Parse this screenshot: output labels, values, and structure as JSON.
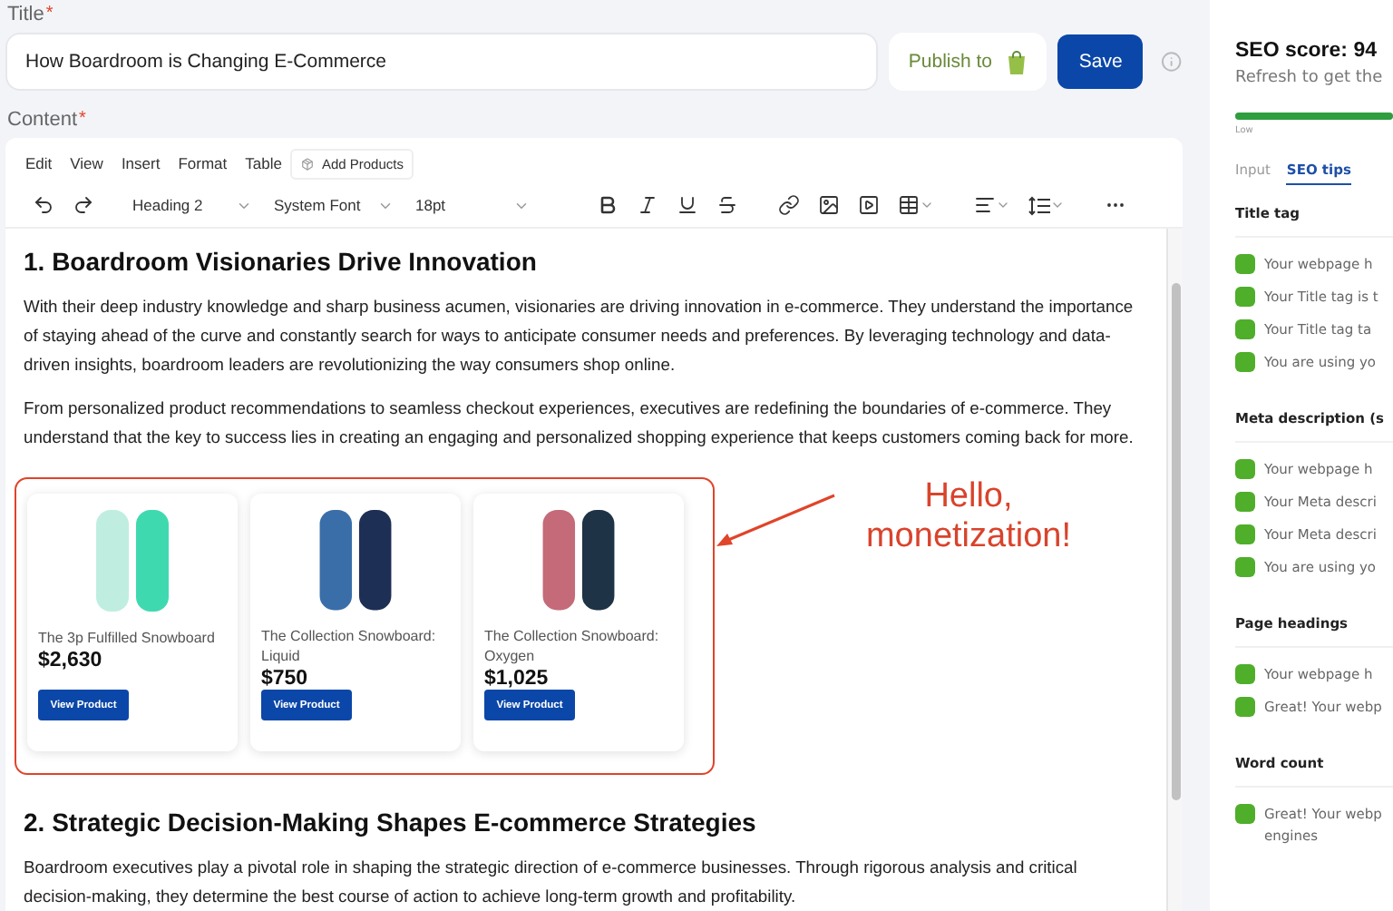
{
  "title_field": {
    "label": "Title",
    "required_mark": "*",
    "value": "How Boardroom is Changing E-Commerce"
  },
  "publish_button": {
    "label": "Publish to"
  },
  "save_button": {
    "label": "Save"
  },
  "content_field": {
    "label": "Content",
    "required_mark": "*"
  },
  "editor": {
    "menu": [
      "Edit",
      "View",
      "Insert",
      "Format",
      "Table"
    ],
    "add_products": "Add Products",
    "selects": [
      {
        "kind": "block",
        "value": "Heading 2"
      },
      {
        "kind": "font",
        "value": "System Font"
      },
      {
        "kind": "size",
        "value": "18pt"
      }
    ],
    "blocks": [
      {
        "kind": "heading",
        "text": "1. Boardroom Visionaries Drive Innovation"
      },
      {
        "kind": "paragraph",
        "text": "With their deep industry knowledge and sharp business acumen, visionaries are driving innovation in e-commerce. They understand the importance of staying ahead of the curve and constantly search for ways to anticipate consumer needs and preferences. By leveraging technology and data-driven insights, boardroom leaders are revolutionizing the way consumers shop online."
      },
      {
        "kind": "paragraph",
        "text": "From personalized product recommendations to seamless checkout experiences, executives are redefining the boundaries of e-commerce. They understand that the key to success lies in creating an engaging and personalized shopping experience that keeps customers coming back for more."
      },
      {
        "kind": "products",
        "annotation": [
          "Hello,",
          "monetization!"
        ],
        "items": [
          {
            "name": "The 3p Fulfilled Snowboard",
            "price": "$2,630",
            "button": "View Product"
          },
          {
            "name": "The Collection Snowboard: Liquid",
            "price": "$750",
            "button": "View Product"
          },
          {
            "name": "The Collection Snowboard: Oxygen",
            "price": "$1,025",
            "button": "View Product"
          }
        ]
      },
      {
        "kind": "heading",
        "text": "2. Strategic Decision-Making Shapes E-commerce Strategies"
      },
      {
        "kind": "paragraph",
        "text": "Boardroom executives play a pivotal role in shaping the strategic direction of e-commerce businesses. Through rigorous analysis and critical decision-making, they determine the best course of action to achieve long-term growth and profitability."
      }
    ]
  },
  "seo_panel": {
    "score": "SEO score: 94",
    "subtitle": "Refresh to get the",
    "meter": {
      "level": 1,
      "label": "Low"
    },
    "tabs": [
      {
        "label": "Input",
        "selected": false
      },
      {
        "label": "SEO tips",
        "selected": true
      }
    ],
    "sections": [
      {
        "title": "Title tag",
        "items": [
          {
            "passed": true,
            "lines": [
              "Your webpage h"
            ]
          },
          {
            "passed": true,
            "lines": [
              "Your Title tag is t"
            ]
          },
          {
            "passed": true,
            "lines": [
              "Your Title tag ta"
            ]
          },
          {
            "passed": true,
            "lines": [
              "You are using yo"
            ]
          }
        ]
      },
      {
        "title": "Meta description (s",
        "items": [
          {
            "passed": true,
            "lines": [
              "Your webpage h"
            ]
          },
          {
            "passed": true,
            "lines": [
              "Your Meta descri"
            ]
          },
          {
            "passed": true,
            "lines": [
              "Your Meta descri"
            ]
          },
          {
            "passed": true,
            "lines": [
              "You are using yo"
            ]
          }
        ]
      },
      {
        "title": "Page headings",
        "items": [
          {
            "passed": true,
            "lines": [
              "Your webpage h"
            ]
          },
          {
            "passed": true,
            "lines": [
              "Great! Your webp"
            ]
          }
        ]
      },
      {
        "title": "Word count",
        "items": [
          {
            "passed": true,
            "lines": [
              "Great! Your webp",
              "engines"
            ]
          }
        ]
      }
    ]
  }
}
